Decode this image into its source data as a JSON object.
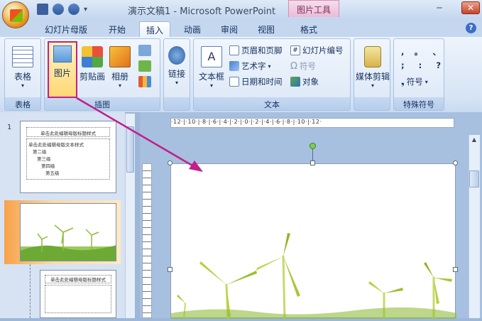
{
  "window": {
    "title": "演示文稿1 - Microsoft PowerPoint",
    "context_tab": "图片工具",
    "minimize": "‒",
    "close": "✕"
  },
  "tabs": [
    {
      "label": "幻灯片母版"
    },
    {
      "label": "开始"
    },
    {
      "label": "插入"
    },
    {
      "label": "动画"
    },
    {
      "label": "审阅"
    },
    {
      "label": "视图"
    },
    {
      "label": "格式"
    }
  ],
  "help": "?",
  "ribbon": {
    "groups": {
      "table": "表格",
      "illustrations": "插图",
      "text": "文本",
      "special_symbols": "特殊符号"
    },
    "table_btn": "表格",
    "picture_btn": "图片",
    "clipart_btn": "剪贴画",
    "album_btn": "相册",
    "link_btn": "链接",
    "textbox_btn": "文本框",
    "header_footer": "页眉和页脚",
    "wordart": "艺术字",
    "datetime": "日期和时间",
    "slide_number": "幻灯片编号",
    "symbol": "符号",
    "object": "对象",
    "media_btn": "媒体剪辑",
    "symbol_btn": "符号",
    "punct": [
      ",",
      "。",
      "、",
      ";",
      ":",
      "?"
    ]
  },
  "slides": {
    "number_1": "1",
    "thumb1_title": "单击此处编辑母版标题样式",
    "thumb1_body": [
      "单击此处编辑母版文本样式",
      "第二级",
      "第三级",
      "第四级",
      "第五级"
    ],
    "thumb3_title": "单击此处编辑母版标题样式"
  },
  "ruler": "·12·|·10·|·8·|·6·|·4·|·2·|·0·|·2·|·4·|·6·|·8·|·10·|·12·",
  "colors": {
    "accent": "#c21f8a",
    "ribbon_bg": "#d6e4f5",
    "window_bg": "#9db7d9"
  }
}
